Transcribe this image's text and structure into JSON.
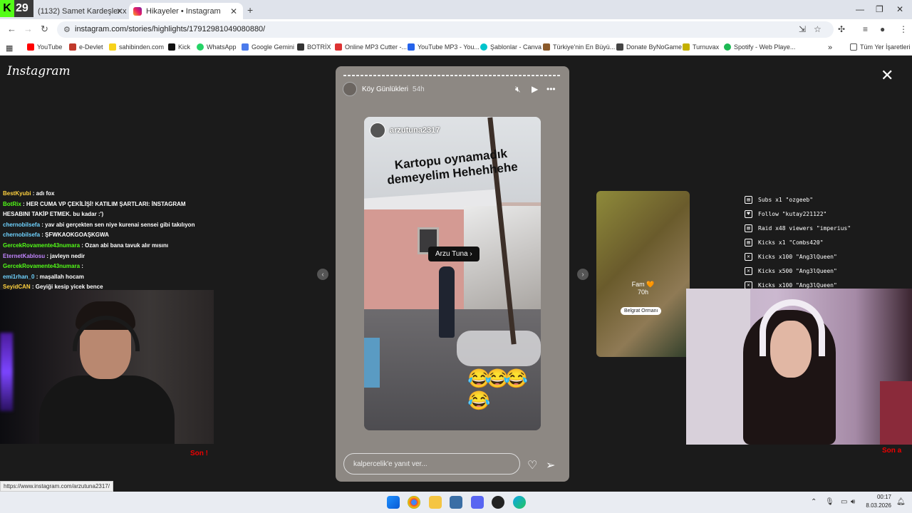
{
  "browser": {
    "kick_badge": "29",
    "tabs": [
      {
        "label": "(1132) Samet Kardeşler x S:"
      },
      {
        "label": "Hikayeler • Instagram"
      }
    ],
    "url": "instagram.com/stories/highlights/17912981049080880/",
    "bookmarks": [
      {
        "label": "YouTube",
        "color": "#ff0000"
      },
      {
        "label": "e-Devlet",
        "color": "#c0392b"
      },
      {
        "label": "sahibinden.com",
        "color": "#f7d21a"
      },
      {
        "label": "Kick",
        "color": "#111111"
      },
      {
        "label": "WhatsApp",
        "color": "#25d366"
      },
      {
        "label": "Google Gemini",
        "color": "#4b7bec"
      },
      {
        "label": "BOTRİX",
        "color": "#333333"
      },
      {
        "label": "Online MP3 Cutter -...",
        "color": "#d33"
      },
      {
        "label": "YouTube MP3 - You...",
        "color": "#2563eb"
      },
      {
        "label": "Şablonlar - Canva",
        "color": "#00c4cc"
      },
      {
        "label": "Türkiye'nin En Büyü...",
        "color": "#8b5a2b"
      },
      {
        "label": "Donate ByNoGame",
        "color": "#444444"
      },
      {
        "label": "Turnuvax",
        "color": "#c4b000"
      },
      {
        "label": "Spotify - Web Playe...",
        "color": "#1db954"
      }
    ],
    "all_bookmarks": "Tüm Yer İşaretleri"
  },
  "instagram": {
    "logo": "Instagram",
    "story": {
      "account": "Köy Günlükleri",
      "time": "54h",
      "inner_user": "arzutuna2317",
      "caption": "Kartopu oynamadık demeyelim Hehehhehe",
      "tag": "Arzu Tuna",
      "emojis": "😂😂😂😂",
      "reply_placeholder": "kalpercelik'e yanıt ver..."
    },
    "next_story": {
      "title": "Fam 🧡",
      "time": "70h",
      "location": "Belgrat Ormanı"
    }
  },
  "stream": {
    "chat": [
      {
        "user": "BestKyubi",
        "user_color": "#ffd23f",
        "msg": ": adı fox"
      },
      {
        "user": "BotRix",
        "user_color": "#53fc18",
        "msg": ": HER CUMA VP ÇEKİLİŞİ! KATILIM ŞARTLARI: İNSTAGRAM HESABINI TAKİP ETMEK. bu kadar :')"
      },
      {
        "user": "chernobilsefa",
        "user_color": "#6fd3ff",
        "msg": ": yav abi gerçekten sen niye kurenai sensei gibi takılıyon"
      },
      {
        "user": "chernobilsefa",
        "user_color": "#6fd3ff",
        "msg": ": ŞFWKAOKGOAŞKGWA"
      },
      {
        "user": "GercekRovamente43numara",
        "user_color": "#53fc18",
        "msg": ": Ozan abi bana tavuk alır mısını"
      },
      {
        "user": "EternetKablosu",
        "user_color": "#c084fc",
        "msg": ": javleyn nedir"
      },
      {
        "user": "GercekRovamente43numara",
        "user_color": "#53fc18",
        "msg": ":"
      },
      {
        "user": "emi1rhan_0",
        "user_color": "#6fd3ff",
        "msg": ": maşallah hocam"
      },
      {
        "user": "SeyidCAN",
        "user_color": "#ffd23f",
        "msg": ": Geyiği kesip yicek bence"
      }
    ],
    "events": [
      {
        "icon": "▤",
        "text": "Subs x1 \"ozgeeb\""
      },
      {
        "icon": "♥",
        "text": "Follow \"kutay221122\""
      },
      {
        "icon": "▤",
        "text": "Raid x48 viewers \"imperius\""
      },
      {
        "icon": "▤",
        "text": "Kicks x1 \"Combs420\""
      },
      {
        "icon": "✕",
        "text": "Kicks x100 \"Ang3lQueen\""
      },
      {
        "icon": "✕",
        "text": "Kicks x500 \"Ang3lQueen\""
      },
      {
        "icon": "✕",
        "text": "Kicks x100 \"Ang3lQueen\""
      }
    ],
    "son_left": "Son !",
    "son_right": "Son a"
  },
  "status_url": "https://www.instagram.com/arzutuna2317/",
  "taskbar": {
    "time": "00:17",
    "date": "8.03.2026"
  }
}
